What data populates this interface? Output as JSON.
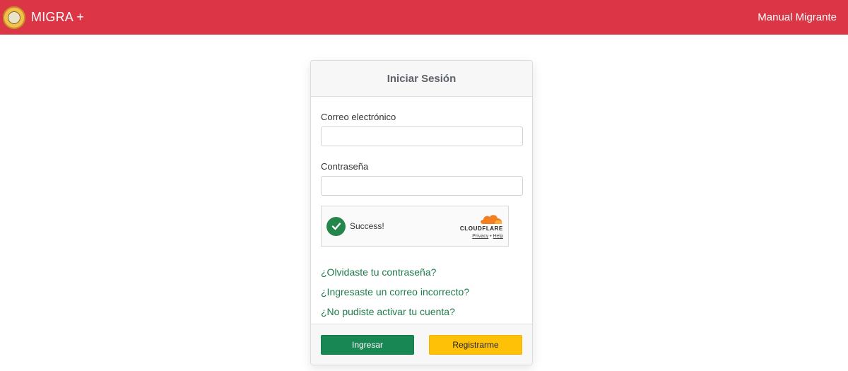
{
  "navbar": {
    "brand": "MIGRA +",
    "manual_link": "Manual Migrante",
    "color": "#dc3545"
  },
  "login": {
    "title": "Iniciar Sesión",
    "email_label": "Correo electrónico",
    "email_value": "",
    "password_label": "Contraseña",
    "password_value": "",
    "captcha": {
      "status": "Success!",
      "provider": "CLOUDFLARE",
      "privacy": "Privacy",
      "separator": "•",
      "help": "Help"
    },
    "links": [
      "¿Olvidaste tu contraseña?",
      "¿Ingresaste un correo incorrecto?",
      "¿No pudiste activar tu cuenta?"
    ],
    "submit_label": "Ingresar",
    "register_label": "Registrarme"
  },
  "colors": {
    "primary_green": "#198754",
    "accent_yellow": "#ffc107",
    "link_green": "#1f7b4a"
  }
}
